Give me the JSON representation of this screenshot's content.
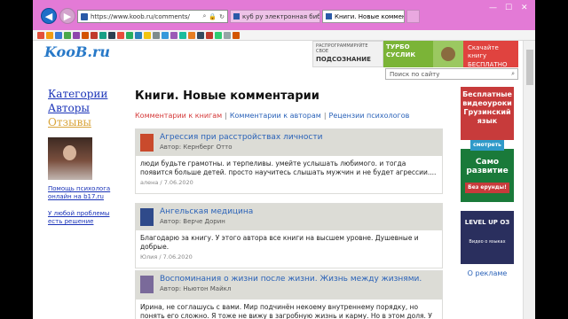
{
  "browser": {
    "address": "https://www.koob.ru/comments/",
    "tabs": [
      {
        "label": "куб ру электронная библиот..."
      },
      {
        "label": "Книги. Новые комментарии"
      }
    ]
  },
  "site": {
    "logo": "KooB",
    "logo_suffix": ".ru",
    "banner": {
      "part1_small": "РАСПРОГРАММИРУЙТЕ СВОЕ",
      "part1_big": "ПОДСОЗНАНИЕ",
      "part2": "ТУРБО СУСЛИК",
      "part3": "Скачайте книгу БЕСПЛАТНО"
    },
    "search_placeholder": "Поиск по сайту"
  },
  "sidebar": {
    "nav": [
      "Категории",
      "Авторы",
      "Отзывы"
    ],
    "link1": "Помощь психолога онлайн на b17.ru",
    "link2": "У любой проблемы есть решение"
  },
  "main": {
    "heading": "Книги. Новые комментарии",
    "subnav": [
      "Комментарии к книгам",
      "Комментарии к авторам",
      "Рецензии психологов"
    ],
    "comments": [
      {
        "title": "Агрессия при расстройствах личности",
        "author": "Автор: Кернберг Отто",
        "text": "люди будьте грамотны. и терпеливы. умейте услышать любимого. и тогда появится больше детей. просто научитесь слышать мужчин и не будет агрессии....",
        "meta": "алена / 7.06.2020"
      },
      {
        "title": "Ангельская медицина",
        "author": "Автор: Верче Дорин",
        "text": "Благодарю за книгу. У этого автора все книги на высшем уровне. Душевные и добрые.",
        "meta": "Юлия / 7.06.2020"
      },
      {
        "title": "Воспоминания о жизни после жизни. Жизнь между жизнями.",
        "author": "Автор: Ньютон Майкл",
        "text": "Ирина, не соглашусь с вами. Мир подчинён некоему внутреннему порядку, но понять его сложно. Я тоже не вижу в загробную жизнь и карму. Но в этом доля. У жесткости его",
        "meta": ""
      }
    ]
  },
  "ads": {
    "ad1_title": "Бесплатные видеоуроки Грузинский язык",
    "ad1_btn": "смотреть",
    "ad2_title": "Само развитие",
    "ad2_btn": "Без ерунды!",
    "ad3_title": "LEVEL UP ОЗ",
    "ad3_sub": "Видео о языках",
    "about": "О рекламе"
  }
}
